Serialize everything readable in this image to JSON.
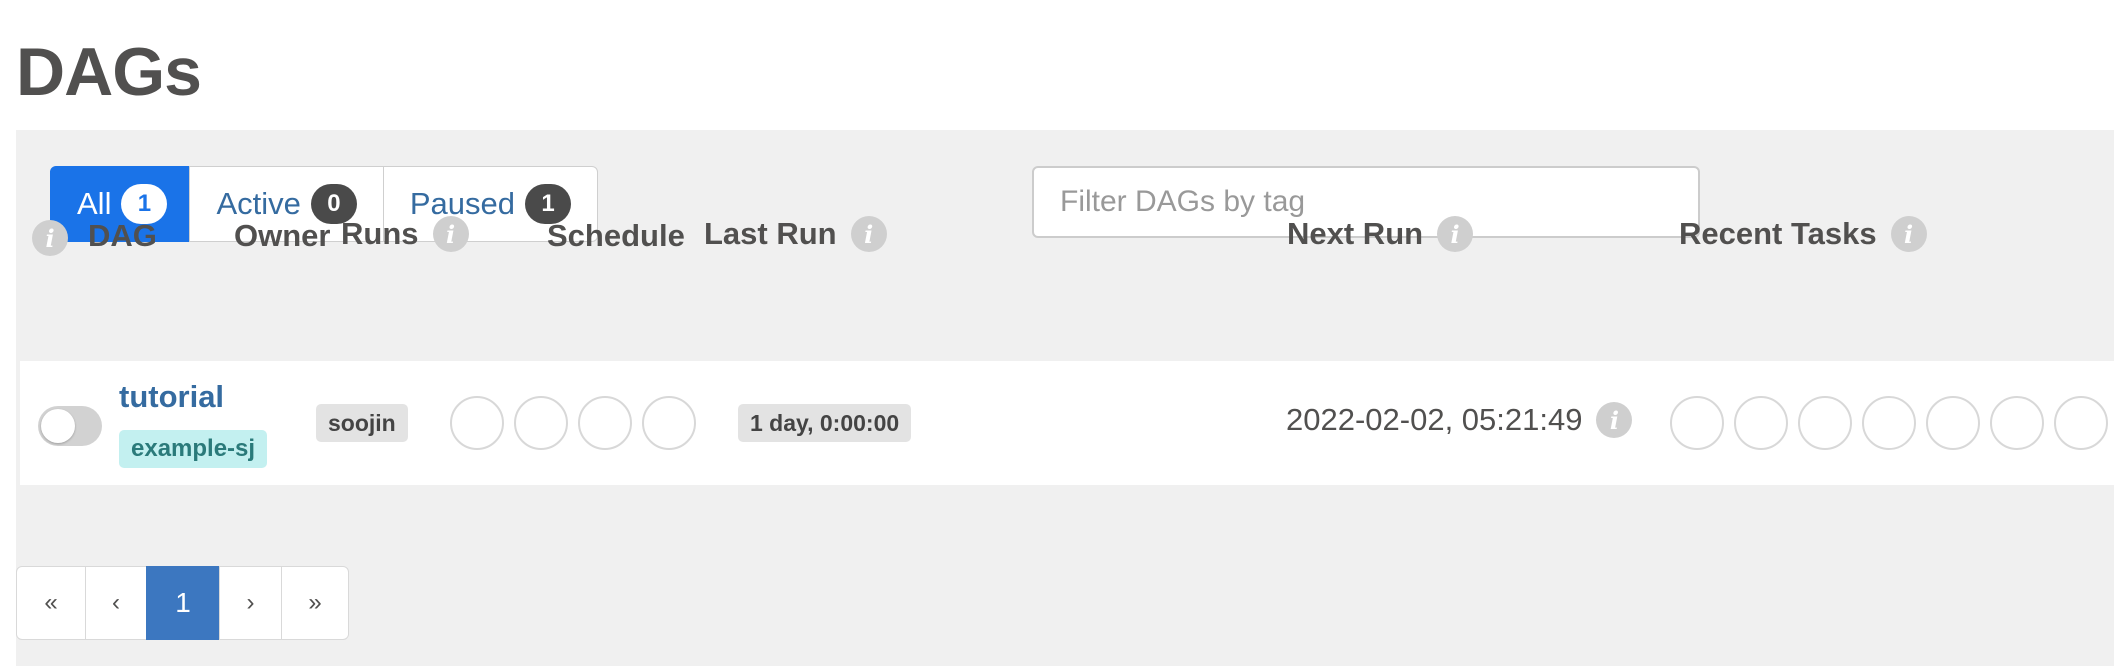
{
  "page": {
    "title": "DAGs"
  },
  "status_filters": [
    {
      "label": "All",
      "count": "1"
    },
    {
      "label": "Active",
      "count": "0"
    },
    {
      "label": "Paused",
      "count": "1"
    }
  ],
  "tag_filter": {
    "placeholder": "Filter DAGs by tag",
    "value": ""
  },
  "table": {
    "headers": {
      "dag": "DAG",
      "owner": "Owner",
      "runs": "Runs",
      "schedule": "Schedule",
      "last_run": "Last Run",
      "next_run": "Next Run",
      "recent_tasks": "Recent Tasks"
    },
    "rows": [
      {
        "dag_id": "tutorial",
        "tag": "example-sj",
        "owner": "soojin",
        "schedule": "1 day, 0:00:00",
        "last_run": "",
        "next_run": "2022-02-02, 05:21:49",
        "paused": true
      }
    ]
  },
  "icons": {
    "info": "info-icon",
    "toggle": "toggle-switch"
  },
  "pagination": {
    "first": "«",
    "prev": "‹",
    "current": "1",
    "next": "›",
    "last": "»"
  },
  "colors": {
    "accent": "#1a73e8",
    "page_current": "#3c77c0",
    "link": "#356ba0",
    "tag_bg": "#c3f0f0",
    "panel_bg": "#f0f0f0"
  }
}
